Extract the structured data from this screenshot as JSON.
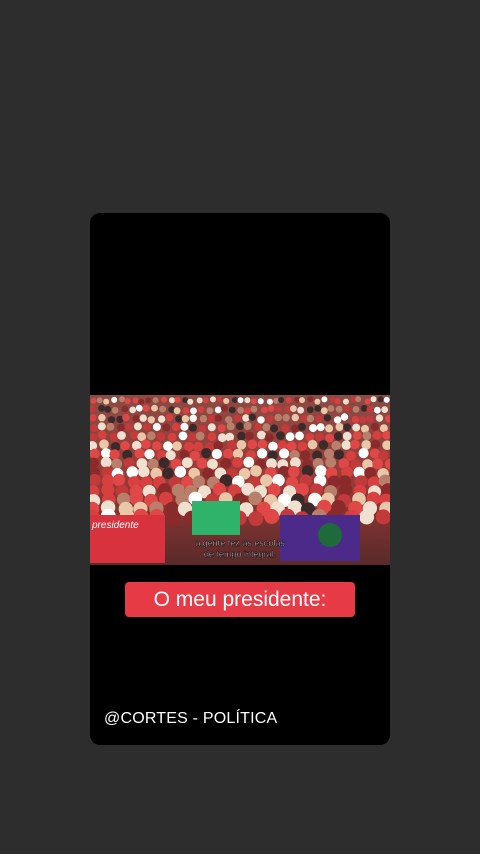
{
  "story": {
    "caption": "O meu presidente:",
    "account_handle": "@CORTES - POLÍTICA"
  },
  "video": {
    "banner_text": "presidente",
    "subtitle_line1": "a gente fez as escolas",
    "subtitle_line2": "de tempo integral."
  },
  "colors": {
    "page_background": "#2e2d2d",
    "card_background": "#000000",
    "caption_background": "#e63a46",
    "caption_text": "#ffffff"
  }
}
